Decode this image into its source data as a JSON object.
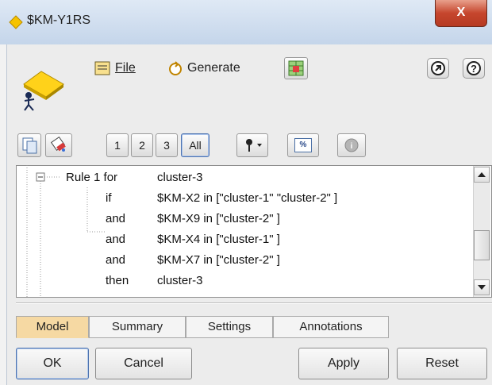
{
  "window": {
    "title": "$KM-Y1RS",
    "close_glyph": "X"
  },
  "menu": {
    "file_label": "File",
    "generate_label": "Generate"
  },
  "toolbar": {
    "levels": [
      "1",
      "2",
      "3"
    ],
    "all_label": "All",
    "percent_label": "%"
  },
  "rules": [
    {
      "kw": "Rule 1 for",
      "expr": "cluster-3"
    },
    {
      "kw": "if",
      "expr": "$KM-X2 in [\"cluster-1\" \"cluster-2\" ]"
    },
    {
      "kw": "and",
      "expr": "$KM-X9 in [\"cluster-2\" ]"
    },
    {
      "kw": "and",
      "expr": "$KM-X4 in [\"cluster-1\" ]"
    },
    {
      "kw": "and",
      "expr": "$KM-X7 in [\"cluster-2\" ]"
    },
    {
      "kw": "then",
      "expr": "cluster-3"
    }
  ],
  "tabs": [
    "Model",
    "Summary",
    "Settings",
    "Annotations"
  ],
  "buttons": {
    "ok": "OK",
    "cancel": "Cancel",
    "apply": "Apply",
    "reset": "Reset"
  },
  "colors": {
    "active_tab": "#f6d9a3",
    "title_bar": "#c4d5ea",
    "close": "#c6462d",
    "icon_yellow": "#ffd21a"
  }
}
